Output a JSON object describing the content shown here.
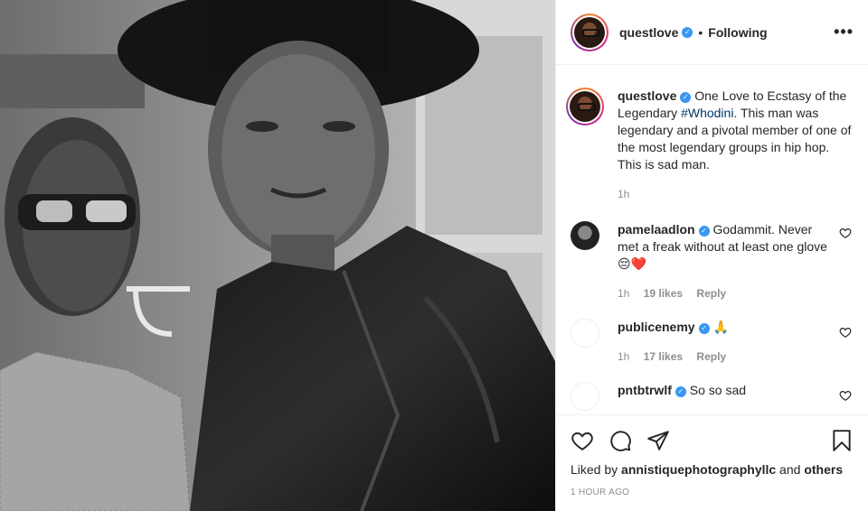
{
  "post": {
    "author": "questlove",
    "follow_status": "Following",
    "more_label": "•••"
  },
  "caption": {
    "user": "questlove",
    "text_before": " One Love to Ecstasy of the Legendary ",
    "hashtag": "#Whodini",
    "text_after": ". This man was legendary and a pivotal member of one of the most legendary groups in hip hop. This is sad man.",
    "time": "1h"
  },
  "comments": [
    {
      "user": "pamelaadlon",
      "text": " Godammit. Never met a freak without at least one glove",
      "emoji": "😔❤️",
      "time": "1h",
      "likes": "19 likes",
      "reply": "Reply"
    },
    {
      "user": "publicenemy",
      "text": " ",
      "emoji": "🙏",
      "time": "1h",
      "likes": "17 likes",
      "reply": "Reply"
    },
    {
      "user": "pntbtrwlf",
      "text": " So so sad",
      "emoji": "",
      "time": "",
      "likes": "",
      "reply": ""
    }
  ],
  "liked_by": {
    "prefix": "Liked by ",
    "user": "annistiquephotographyllc",
    "middle": " and ",
    "others": "others"
  },
  "timestamp": "1 HOUR AGO",
  "icons": [
    "heart-icon",
    "comment-icon",
    "share-icon",
    "bookmark-icon",
    "verified-badge-icon",
    "more-options-icon"
  ],
  "colors": {
    "verified": "#3897f0",
    "hashtag": "#00376b",
    "muted": "#8e8e8e"
  }
}
